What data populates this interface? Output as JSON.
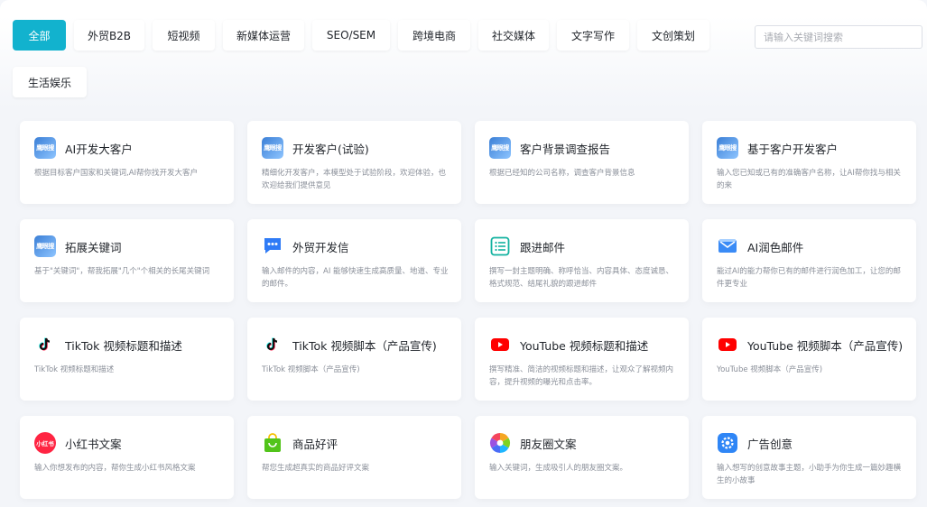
{
  "filters": {
    "tags": [
      "全部",
      "外贸B2B",
      "短视频",
      "新媒体运营",
      "SEO/SEM",
      "跨境电商",
      "社交媒体",
      "文字写作",
      "文创策划",
      "生活娱乐"
    ],
    "active_index": 0,
    "search_placeholder": "请输入关键词搜索",
    "accent_color": "#12b2ce"
  },
  "cards": [
    {
      "title": "AI开发大客户",
      "desc": "根据目标客户国家和关键词,AI帮你找开发大客户",
      "icon": "brand-logo-icon",
      "icon_text": "鹰眼搜"
    },
    {
      "title": "开发客户(试验)",
      "desc": "精细化开发客户，本模型处于试验阶段，欢迎体验，也欢迎给我们提供意见",
      "icon": "brand-logo-icon",
      "icon_text": "鹰眼搜"
    },
    {
      "title": "客户背景调查报告",
      "desc": "根据已经知的公司名称，调查客户背景信息",
      "icon": "brand-logo-icon",
      "icon_text": "鹰眼搜"
    },
    {
      "title": "基于客户开发客户",
      "desc": "输入您已知或已有的准确客户名称，让AI帮你找与相关的来",
      "icon": "brand-logo-icon",
      "icon_text": "鹰眼搜"
    },
    {
      "title": "拓展关键词",
      "desc": "基于\"关键词\"，帮我拓展\"几个\"个相关的长尾关键词",
      "icon": "brand-logo-icon",
      "icon_text": "鹰眼搜"
    },
    {
      "title": "外贸开发信",
      "desc": "输入邮件的内容，AI 能够快速生成高质量、地道、专业的邮件。",
      "icon": "chat-bubble-icon",
      "icon_text": ""
    },
    {
      "title": "跟进邮件",
      "desc": "撰写一封主题明确、称呼恰当、内容具体、态度诚恳、格式规范、结尾礼貌的跟进邮件",
      "icon": "list-icon",
      "icon_text": ""
    },
    {
      "title": "AI润色邮件",
      "desc": "能过AI的能力帮你已有的邮件进行润色加工，让您的邮件更专业",
      "icon": "mail-icon",
      "icon_text": ""
    },
    {
      "title": "TikTok 视频标题和描述",
      "desc": "TikTok 视频标题和描述",
      "icon": "tiktok-icon",
      "icon_text": ""
    },
    {
      "title": "TikTok 视频脚本（产品宣传)",
      "desc": "TikTok 视频脚本（产品宣传)",
      "icon": "tiktok-icon",
      "icon_text": ""
    },
    {
      "title": "YouTube 视频标题和描述",
      "desc": "撰写精准、简洁的视频标题和描述，让观众了解视频内容，提升视频的曝光和点击率。",
      "icon": "youtube-icon",
      "icon_text": ""
    },
    {
      "title": "YouTube 视频脚本（产品宣传)",
      "desc": "YouTube 视频脚本（产品宣传)",
      "icon": "youtube-icon",
      "icon_text": ""
    },
    {
      "title": "小红书文案",
      "desc": "输入你想发布的内容，帮你生成小红书风格文案",
      "icon": "xiaohongshu-icon",
      "icon_text": "小红书"
    },
    {
      "title": "商品好评",
      "desc": "帮您生成超真实的商品好评文案",
      "icon": "shopping-bag-icon",
      "icon_text": ""
    },
    {
      "title": "朋友圈文案",
      "desc": "输入关键词，生成吸引人的朋友圈文案。",
      "icon": "aperture-icon",
      "icon_text": ""
    },
    {
      "title": "广告创意",
      "desc": "输入想写的创意故事主题，小助手为你生成一篇妙趣横生的小故事",
      "icon": "gear-badge-icon",
      "icon_text": ""
    }
  ]
}
